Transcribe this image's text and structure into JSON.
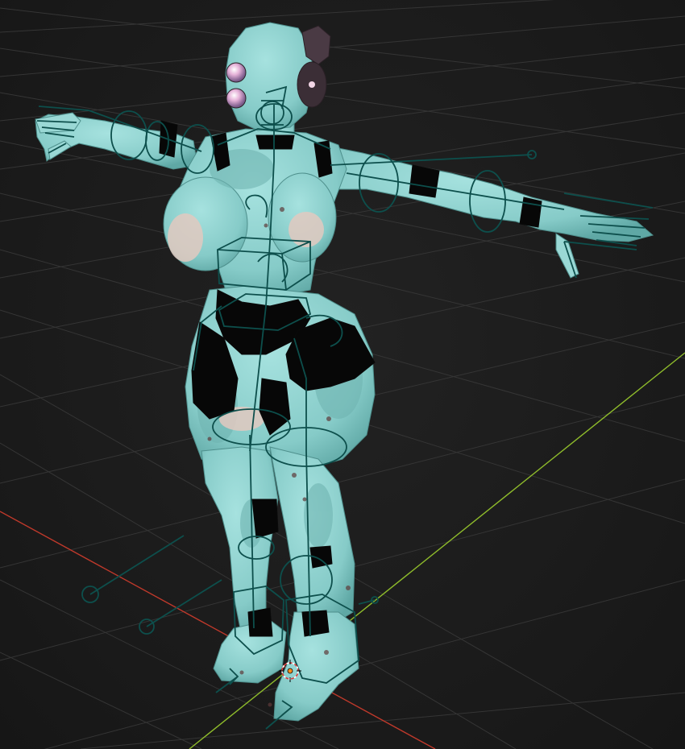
{
  "viewport": {
    "mode": "object-mode",
    "shading": "material-preview",
    "overlays": "armature-with-custom-bone-shapes"
  },
  "colors": {
    "background": "#1b1b1b",
    "grid": "#3a3a3a",
    "x_axis": "#c0392b",
    "y_axis": "#8fbc2b",
    "body": "#8fd3d0",
    "body_shadow": "#6fb7b4",
    "dark_parts": "#0a0a0a",
    "bone_outline": "#0d4f4c",
    "origin": "#ff8c1a"
  },
  "icons": [
    "object-origin-icon",
    "3d-cursor-icon"
  ]
}
